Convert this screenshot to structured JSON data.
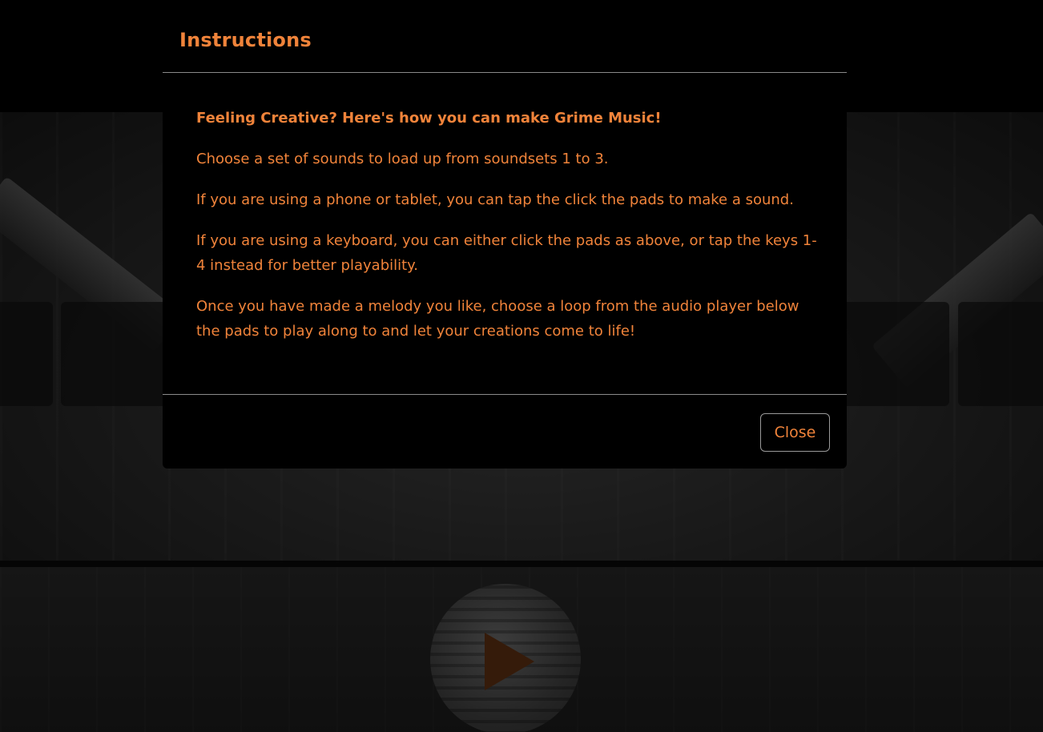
{
  "background": {
    "accent_color": "#f0833a",
    "play_icon": "play-icon"
  },
  "modal": {
    "title": "Instructions",
    "paragraphs": {
      "lead": "Feeling Creative? Here's how you can make Grime Music!",
      "p1": "Choose a set of sounds to load up from soundsets 1 to 3.",
      "p2": "If you are using a phone or tablet, you can tap the click the pads to make a sound.",
      "p3": "If you are using a keyboard, you can either click the pads as above, or tap the keys 1-4 instead for better playability.",
      "p4": "Once you have made a melody you like, choose a loop from the audio player below the pads to play along to and let your creations come to life!"
    },
    "close_label": "Close"
  }
}
